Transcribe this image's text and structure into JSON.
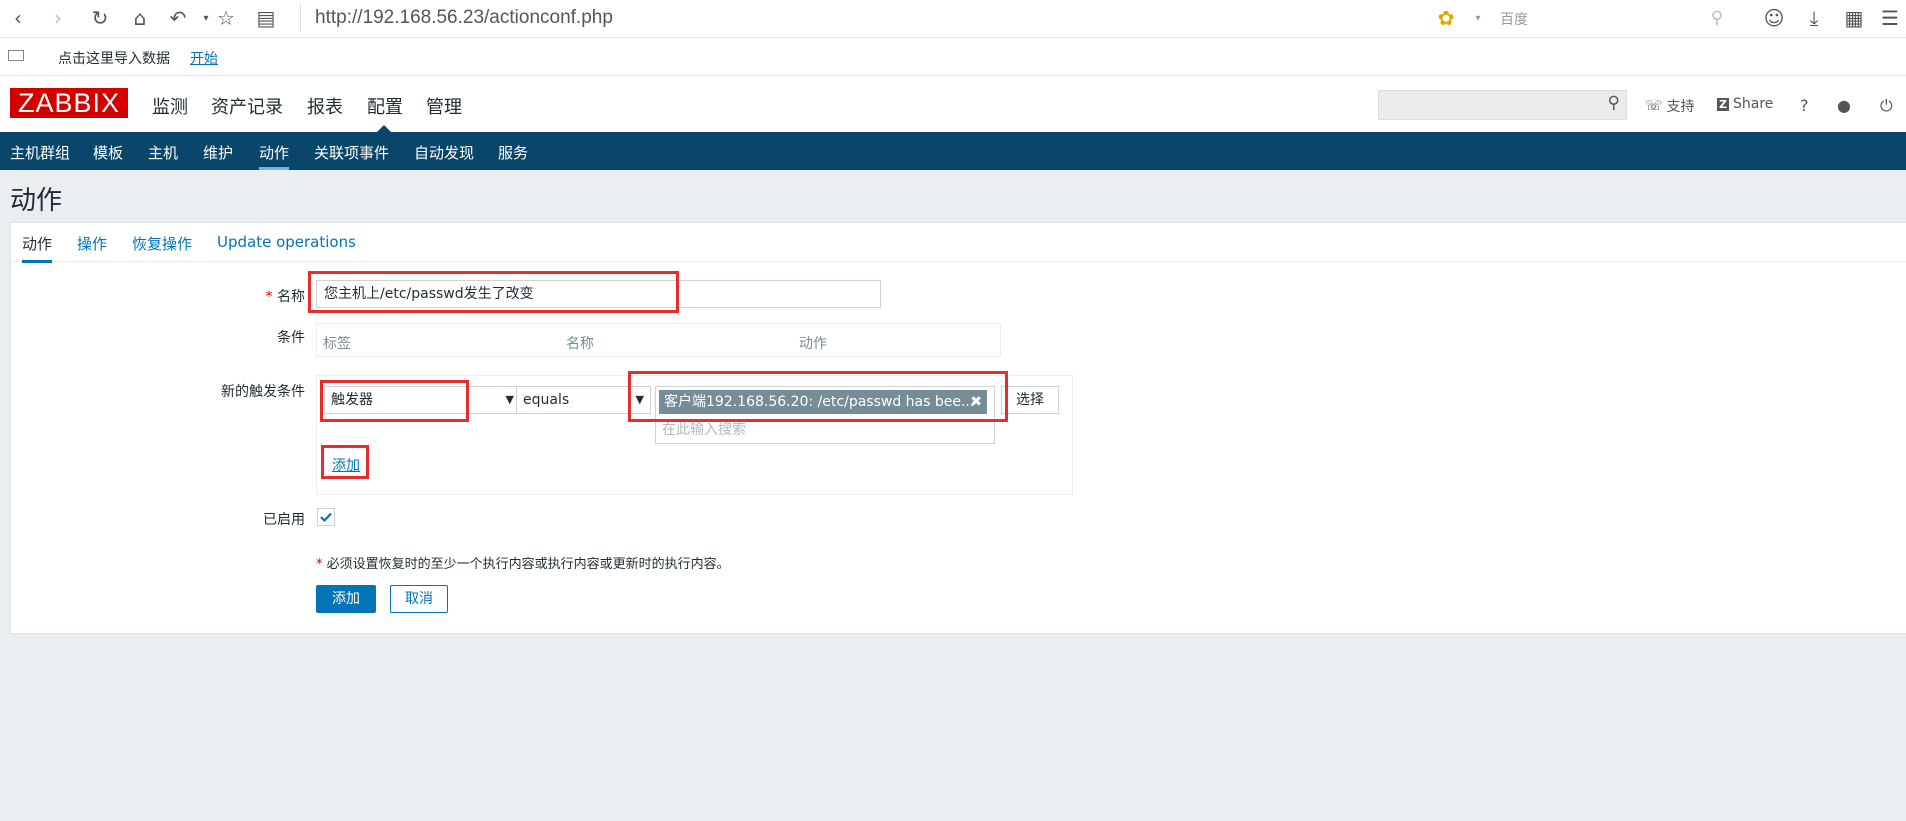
{
  "browser": {
    "url": "http://192.168.56.23/actionconf.php",
    "search_engine": "百度",
    "bookmark_text": "点击这里导入数据",
    "bookmark_link": "开始"
  },
  "header": {
    "logo": "ZABBIX",
    "menu": [
      "监测",
      "资产记录",
      "报表",
      "配置",
      "管理"
    ],
    "support": "支持",
    "share": "Share",
    "help": "?"
  },
  "subnav": [
    "主机群组",
    "模板",
    "主机",
    "维护",
    "动作",
    "关联项事件",
    "自动发现",
    "服务"
  ],
  "page": {
    "title": "动作",
    "tabs": [
      "动作",
      "操作",
      "恢复操作",
      "Update operations"
    ]
  },
  "form": {
    "name_label": "名称",
    "name_value": "您主机上/etc/passwd发生了改变",
    "conditions_label": "条件",
    "conditions_columns": [
      "标签",
      "名称",
      "动作"
    ],
    "new_condition_label": "新的触发条件",
    "condition_type": "触发器",
    "operator": "equals",
    "selected_trigger": "客户端192.168.56.20: /etc/passwd has bee...",
    "search_placeholder": "在此输入搜索",
    "select_button": "选择",
    "add_condition_link": "添加",
    "enabled_label": "已启用",
    "required_note": "必须设置恢复时的至少一个执行内容或执行内容或更新时的执行内容。",
    "add_button": "添加",
    "cancel_button": "取消"
  },
  "colors": {
    "logo_red": "#d40000",
    "subnav_bg": "#0a466a",
    "link_blue": "#0275b8",
    "highlight_red": "#e52d2d"
  }
}
